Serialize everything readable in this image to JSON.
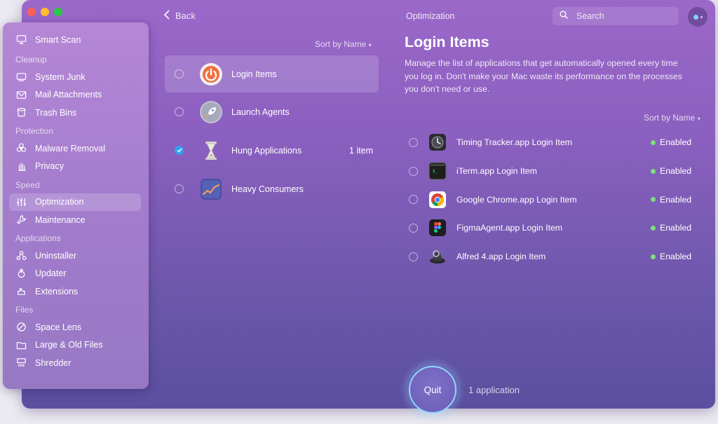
{
  "top_bar": {
    "back_label": "Back",
    "title": "Optimization",
    "search_placeholder": "Search"
  },
  "sidebar": {
    "smart_scan": "Smart Scan",
    "sections": [
      {
        "title": "Cleanup",
        "items": [
          {
            "label": "System Junk",
            "icon": "system-junk-icon"
          },
          {
            "label": "Mail Attachments",
            "icon": "mail-icon"
          },
          {
            "label": "Trash Bins",
            "icon": "trash-icon"
          }
        ]
      },
      {
        "title": "Protection",
        "items": [
          {
            "label": "Malware Removal",
            "icon": "biohazard-icon"
          },
          {
            "label": "Privacy",
            "icon": "hand-icon"
          }
        ]
      },
      {
        "title": "Speed",
        "items": [
          {
            "label": "Optimization",
            "icon": "sliders-icon",
            "active": true
          },
          {
            "label": "Maintenance",
            "icon": "wrench-icon"
          }
        ]
      },
      {
        "title": "Applications",
        "items": [
          {
            "label": "Uninstaller",
            "icon": "uninstaller-icon"
          },
          {
            "label": "Updater",
            "icon": "updater-icon"
          },
          {
            "label": "Extensions",
            "icon": "extensions-icon"
          }
        ]
      },
      {
        "title": "Files",
        "items": [
          {
            "label": "Space Lens",
            "icon": "space-lens-icon"
          },
          {
            "label": "Large & Old Files",
            "icon": "folder-icon"
          },
          {
            "label": "Shredder",
            "icon": "shredder-icon"
          }
        ]
      }
    ]
  },
  "middle": {
    "sort_label": "Sort by Name",
    "items": [
      {
        "label": "Login Items",
        "icon": "power-icon",
        "selected": true,
        "checked": false,
        "count": ""
      },
      {
        "label": "Launch Agents",
        "icon": "rocket-icon",
        "selected": false,
        "checked": false,
        "count": ""
      },
      {
        "label": "Hung Applications",
        "icon": "hourglass-icon",
        "selected": false,
        "checked": true,
        "count": "1 item"
      },
      {
        "label": "Heavy Consumers",
        "icon": "chart-icon",
        "selected": false,
        "checked": false,
        "count": ""
      }
    ]
  },
  "right": {
    "title": "Login Items",
    "description": "Manage the list of applications that get automatically opened every time you log in. Don't make your Mac waste its performance on the processes you don't need or use.",
    "sort_label": "Sort by Name",
    "items": [
      {
        "name": "Timing Tracker.app Login Item",
        "icon": "timing-app-icon",
        "status": "Enabled"
      },
      {
        "name": "iTerm.app Login Item",
        "icon": "iterm-app-icon",
        "status": "Enabled"
      },
      {
        "name": "Google Chrome.app Login Item",
        "icon": "chrome-app-icon",
        "status": "Enabled"
      },
      {
        "name": "FigmaAgent.app Login Item",
        "icon": "figma-app-icon",
        "status": "Enabled"
      },
      {
        "name": "Alfred 4.app Login Item",
        "icon": "alfred-app-icon",
        "status": "Enabled"
      }
    ]
  },
  "bottom": {
    "quit_label": "Quit",
    "app_count": "1 application"
  },
  "colors": {
    "enabled_dot": "#7ee07a",
    "check_blue": "#2fa0ef",
    "quit_ring": "#8fd8ff"
  }
}
